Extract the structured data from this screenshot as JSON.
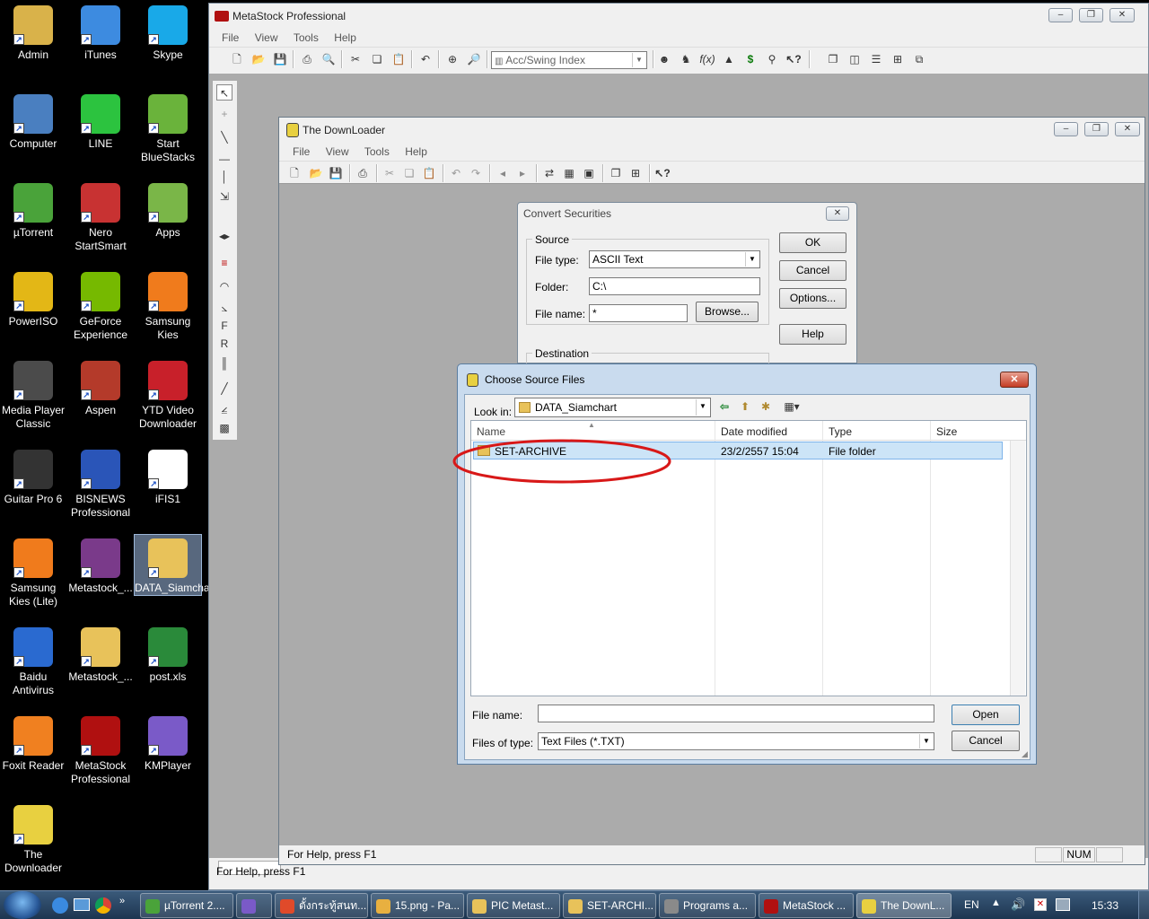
{
  "desktop": {
    "icons": [
      {
        "label": "Admin",
        "color": "#d9b24a"
      },
      {
        "label": "iTunes",
        "color": "#3d8be0"
      },
      {
        "label": "Skype",
        "color": "#19a9e8"
      },
      {
        "label": "Computer",
        "color": "#4a7fc0"
      },
      {
        "label": "LINE",
        "color": "#2cc33f"
      },
      {
        "label": "Start BlueStacks",
        "color": "#6ab33b"
      },
      {
        "label": "µTorrent",
        "color": "#4aa33a"
      },
      {
        "label": "Nero StartSmart",
        "color": "#c83232"
      },
      {
        "label": "Apps",
        "color": "#7ab648"
      },
      {
        "label": "PowerISO",
        "color": "#e3b716"
      },
      {
        "label": "GeForce Experience",
        "color": "#76b900"
      },
      {
        "label": "Samsung Kies",
        "color": "#f07b1c"
      },
      {
        "label": "Media Player Classic",
        "color": "#4b4b4b"
      },
      {
        "label": "Aspen",
        "color": "#b43a2a"
      },
      {
        "label": "YTD Video Downloader",
        "color": "#c8202a"
      },
      {
        "label": "Guitar Pro 6",
        "color": "#333333"
      },
      {
        "label": "BISNEWS Professional",
        "color": "#2a55b8"
      },
      {
        "label": "iFIS1",
        "color": "#ffffff"
      },
      {
        "label": "Samsung Kies (Lite)",
        "color": "#f07b1c"
      },
      {
        "label": "Metastock_...",
        "color": "#7a3a8a"
      },
      {
        "label": "DATA_Siamchart",
        "color": "#e8c25a"
      },
      {
        "label": "Baidu Antivirus",
        "color": "#2a6ad0"
      },
      {
        "label": "Metastock_...",
        "color": "#e8c25a"
      },
      {
        "label": "post.xls",
        "color": "#2a8a3a"
      },
      {
        "label": "Foxit Reader",
        "color": "#f08020"
      },
      {
        "label": "MetaStock Professional",
        "color": "#b01010"
      },
      {
        "label": "KMPlayer",
        "color": "#7a5ac8"
      },
      {
        "label": "The Downloader",
        "color": "#e8d040"
      }
    ]
  },
  "metastock": {
    "title": "MetaStock Professional",
    "menu": [
      "File",
      "View",
      "Tools",
      "Help"
    ],
    "indicator": "Acc/Swing Index",
    "status": "For Help, press F1"
  },
  "downloader": {
    "title": "The DownLoader",
    "menu": [
      "File",
      "View",
      "Tools",
      "Help"
    ],
    "status": "For Help, press F1",
    "num": "NUM"
  },
  "convert": {
    "title": "Convert Securities",
    "source_label": "Source",
    "file_type_label": "File type:",
    "file_type_value": "ASCII Text",
    "folder_label": "Folder:",
    "folder_value": "C:\\",
    "file_name_label": "File name:",
    "file_name_value": "*",
    "browse": "Browse...",
    "ok": "OK",
    "cancel": "Cancel",
    "options": "Options...",
    "help": "Help",
    "destination_label": "Destination"
  },
  "choose": {
    "title": "Choose Source Files",
    "look_in_label": "Look in:",
    "look_in_value": "DATA_Siamchart",
    "columns": [
      "Name",
      "Date modified",
      "Type",
      "Size"
    ],
    "rows": [
      {
        "name": "SET-ARCHIVE",
        "date": "23/2/2557 15:04",
        "type": "File folder",
        "size": ""
      }
    ],
    "file_name_label": "File name:",
    "file_name_value": "",
    "file_type_label": "Files of type:",
    "file_type_value": "Text Files (*.TXT)",
    "open": "Open",
    "cancel": "Cancel"
  },
  "taskbar": {
    "items": [
      {
        "label": "µTorrent 2....",
        "color": "#4aa33a"
      },
      {
        "label": "",
        "color": "#7a5ac8"
      },
      {
        "label": "ตั้งกระทู้สนท...",
        "color": "#e04a2a"
      },
      {
        "label": "15.png - Pa...",
        "color": "#e8b040"
      },
      {
        "label": "PIC Metast...",
        "color": "#e8c25a"
      },
      {
        "label": "SET-ARCHI...",
        "color": "#e8c25a"
      },
      {
        "label": "Programs a...",
        "color": "#8a8a8a"
      },
      {
        "label": "MetaStock ...",
        "color": "#b01010"
      },
      {
        "label": "The DownL...",
        "color": "#e8d040"
      }
    ],
    "lang": "EN",
    "time": "15:33"
  }
}
